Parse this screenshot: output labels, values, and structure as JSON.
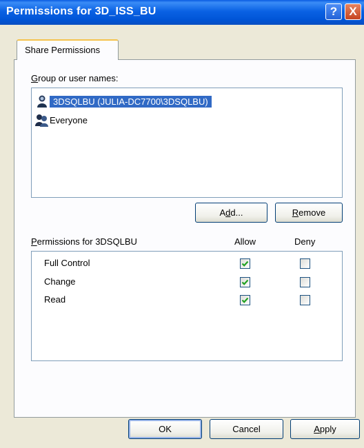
{
  "window": {
    "title": "Permissions for 3D_ISS_BU",
    "help_glyph": "?",
    "close_glyph": "X"
  },
  "tabs": [
    {
      "label": "Share Permissions",
      "active": true
    }
  ],
  "group_label": {
    "accel": "G",
    "rest": "roup or user names:"
  },
  "users": [
    {
      "label": "3DSQLBU (JULIA-DC7700\\3DSQLBU)",
      "icon": "user-icon",
      "selected": true
    },
    {
      "label": "Everyone",
      "icon": "group-icon",
      "selected": false
    }
  ],
  "buttons": {
    "add": {
      "pre": "A",
      "accel": "d",
      "post": "d..."
    },
    "remove": {
      "pre": "",
      "accel": "R",
      "post": "emove"
    },
    "ok": "OK",
    "cancel": "Cancel",
    "apply": {
      "accel": "A",
      "rest": "pply"
    }
  },
  "permissions": {
    "header": {
      "accel": "P",
      "rest": "ermissions for 3DSQLBU"
    },
    "allow_label": "Allow",
    "deny_label": "Deny",
    "rows": [
      {
        "name": "Full Control",
        "allow": true,
        "deny": false
      },
      {
        "name": "Change",
        "allow": true,
        "deny": false
      },
      {
        "name": "Read",
        "allow": true,
        "deny": false
      }
    ]
  },
  "colors": {
    "titlebar": "#0054e3",
    "selection": "#316ac5",
    "check": "#21a121",
    "face": "#ece9d8"
  }
}
